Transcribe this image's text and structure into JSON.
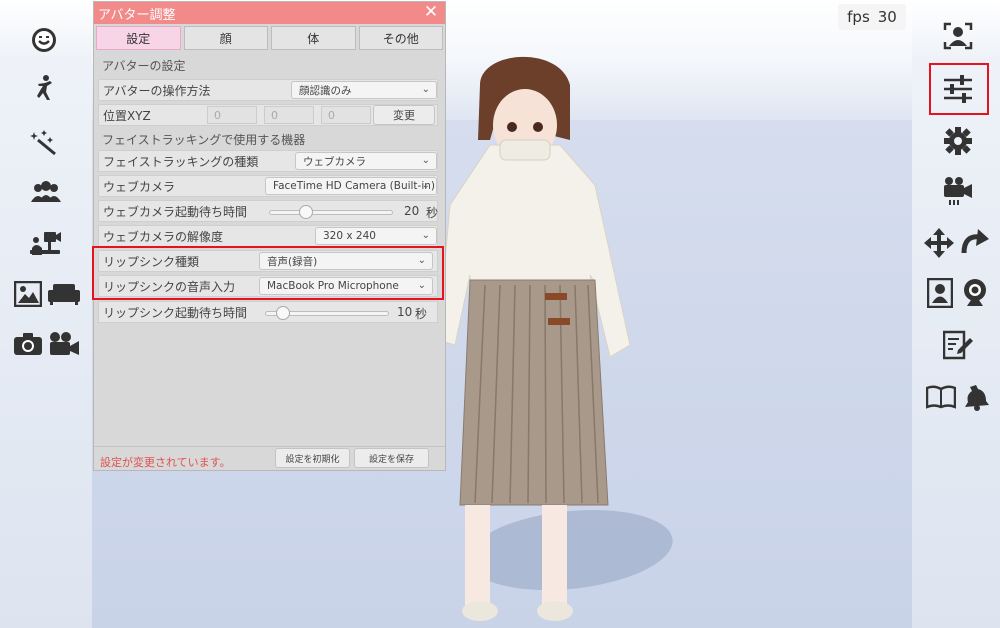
{
  "fps": {
    "label": "fps",
    "value": "30"
  },
  "dialog": {
    "title": "アバター調整",
    "close": "✕",
    "tabs": [
      "設定",
      "顔",
      "体",
      "その他"
    ],
    "section_avatar": "アバターの設定",
    "operation_label": "アバターの操作方法",
    "operation_value": "顔認識のみ",
    "position_label": "位置XYZ",
    "position_values": [
      "0",
      "0",
      "0"
    ],
    "change_button": "変更",
    "section_devices": "フェイストラッキングで使用する機器",
    "tracking_type_label": "フェイストラッキングの種類",
    "tracking_type_value": "ウェブカメラ",
    "webcam_label": "ウェブカメラ",
    "webcam_value": "FaceTime HD Camera (Built-in)",
    "webcam_wait_label": "ウェブカメラ起動待ち時間",
    "webcam_wait_value": "20",
    "webcam_wait_unit": "秒",
    "webcam_wait_fraction": 0.27,
    "resolution_label": "ウェブカメラの解像度",
    "resolution_value": "320 x 240",
    "lipsync_type_label": "リップシンク種類",
    "lipsync_type_value": "音声(録音)",
    "lipsync_input_label": "リップシンクの音声入力",
    "lipsync_input_value": "MacBook Pro Microphone",
    "lipsync_wait_label": "リップシンク起動待ち時間",
    "lipsync_wait_value": "10",
    "lipsync_wait_unit": "秒",
    "lipsync_wait_fraction": 0.1,
    "status_text": "設定が変更されています。",
    "reset_button": "設定を初期化",
    "save_button": "設定を保存"
  },
  "colors": {
    "accent": "#e8121e",
    "title_bar": "#f28a8a",
    "active_tab": "#f7d4e6",
    "icon": "#333333"
  },
  "left_icons": [
    "face-icon",
    "pose-icon",
    "effects-icon",
    "group-icon",
    "camera-stand-icon",
    "image-icon",
    "sofa-icon",
    "camera-icon",
    "video-camera-icon"
  ],
  "right_icons": [
    "face-tracking-icon",
    "sliders-icon",
    "gear-icon",
    "video-switch-icon",
    "move-icon",
    "rotate-icon",
    "portrait-icon",
    "webcam-icon",
    "edit-icon",
    "book-icon",
    "bell-icon"
  ]
}
